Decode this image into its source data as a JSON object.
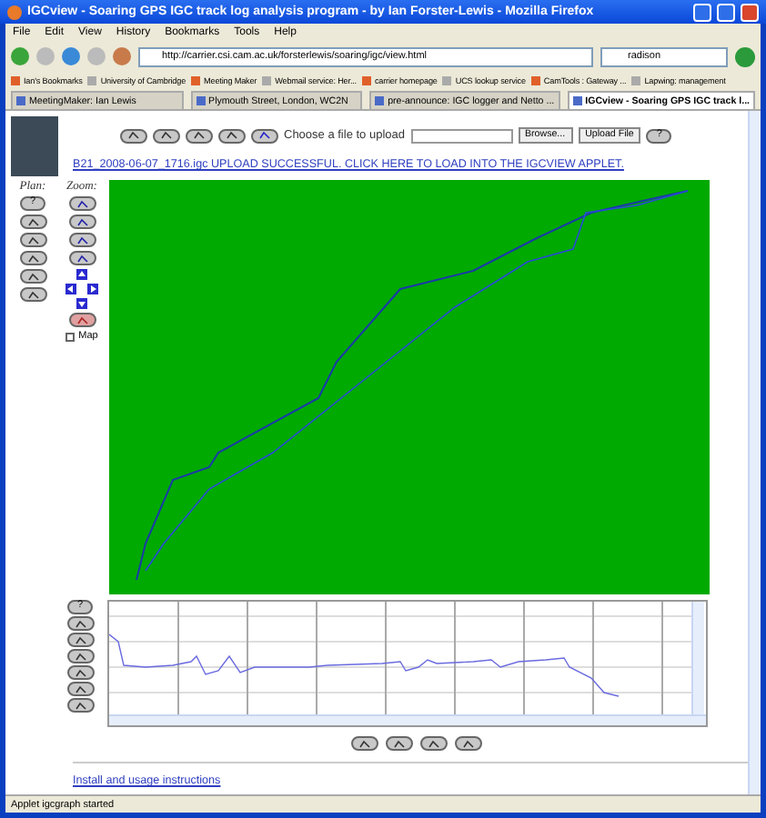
{
  "window": {
    "title": "IGCview - Soaring GPS IGC track log analysis program - by Ian Forster-Lewis - Mozilla Firefox"
  },
  "menu": [
    "File",
    "Edit",
    "View",
    "History",
    "Bookmarks",
    "Tools",
    "Help"
  ],
  "navigation": {
    "url": "http://carrier.csi.cam.ac.uk/forsterlewis/soaring/igc/view.html",
    "search": "radison"
  },
  "bookmarks": [
    "Ian's Bookmarks",
    "University of Cambridge",
    "Meeting Maker",
    "Webmail service: Her...",
    "carrier homepage",
    "UCS lookup service",
    "CamTools : Gateway ...",
    "Lapwing: management"
  ],
  "tabs": [
    {
      "label": "MeetingMaker: Ian Lewis",
      "selected": false
    },
    {
      "label": "Plymouth Street, London, WC2N",
      "selected": false
    },
    {
      "label": "pre-announce: IGC logger and Netto ...",
      "selected": false
    },
    {
      "label": "IGCview - Soaring GPS IGC track l...",
      "selected": true
    }
  ],
  "upload": {
    "label": "Choose a file to upload",
    "browse": "Browse...",
    "submit": "Upload File",
    "help": "?"
  },
  "message": "B21_2008-06-07_1716.igc UPLOAD SUCCESSFUL. CLICK HERE TO LOAD INTO THE IGCVIEW APPLET.",
  "plan": {
    "label": "Plan:",
    "help": "?"
  },
  "zoom": {
    "label": "Zoom:"
  },
  "map_option": {
    "label": "Map",
    "checked": false
  },
  "graph": {
    "help": "?"
  },
  "footer_link": "Install and usage instructions",
  "status": "Applet igcgraph started"
}
